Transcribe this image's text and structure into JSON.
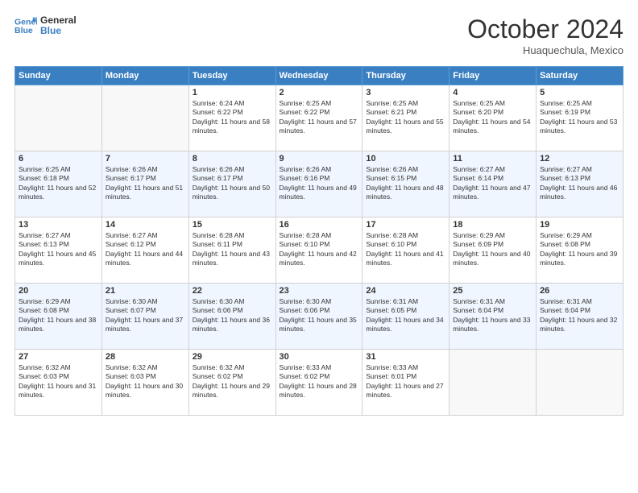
{
  "logo": {
    "line1": "General",
    "line2": "Blue"
  },
  "header": {
    "month": "October 2024",
    "location": "Huaquechula, Mexico"
  },
  "weekdays": [
    "Sunday",
    "Monday",
    "Tuesday",
    "Wednesday",
    "Thursday",
    "Friday",
    "Saturday"
  ],
  "weeks": [
    [
      {
        "day": "",
        "info": ""
      },
      {
        "day": "",
        "info": ""
      },
      {
        "day": "1",
        "info": "Sunrise: 6:24 AM\nSunset: 6:22 PM\nDaylight: 11 hours and 58 minutes."
      },
      {
        "day": "2",
        "info": "Sunrise: 6:25 AM\nSunset: 6:22 PM\nDaylight: 11 hours and 57 minutes."
      },
      {
        "day": "3",
        "info": "Sunrise: 6:25 AM\nSunset: 6:21 PM\nDaylight: 11 hours and 55 minutes."
      },
      {
        "day": "4",
        "info": "Sunrise: 6:25 AM\nSunset: 6:20 PM\nDaylight: 11 hours and 54 minutes."
      },
      {
        "day": "5",
        "info": "Sunrise: 6:25 AM\nSunset: 6:19 PM\nDaylight: 11 hours and 53 minutes."
      }
    ],
    [
      {
        "day": "6",
        "info": "Sunrise: 6:25 AM\nSunset: 6:18 PM\nDaylight: 11 hours and 52 minutes."
      },
      {
        "day": "7",
        "info": "Sunrise: 6:26 AM\nSunset: 6:17 PM\nDaylight: 11 hours and 51 minutes."
      },
      {
        "day": "8",
        "info": "Sunrise: 6:26 AM\nSunset: 6:17 PM\nDaylight: 11 hours and 50 minutes."
      },
      {
        "day": "9",
        "info": "Sunrise: 6:26 AM\nSunset: 6:16 PM\nDaylight: 11 hours and 49 minutes."
      },
      {
        "day": "10",
        "info": "Sunrise: 6:26 AM\nSunset: 6:15 PM\nDaylight: 11 hours and 48 minutes."
      },
      {
        "day": "11",
        "info": "Sunrise: 6:27 AM\nSunset: 6:14 PM\nDaylight: 11 hours and 47 minutes."
      },
      {
        "day": "12",
        "info": "Sunrise: 6:27 AM\nSunset: 6:13 PM\nDaylight: 11 hours and 46 minutes."
      }
    ],
    [
      {
        "day": "13",
        "info": "Sunrise: 6:27 AM\nSunset: 6:13 PM\nDaylight: 11 hours and 45 minutes."
      },
      {
        "day": "14",
        "info": "Sunrise: 6:27 AM\nSunset: 6:12 PM\nDaylight: 11 hours and 44 minutes."
      },
      {
        "day": "15",
        "info": "Sunrise: 6:28 AM\nSunset: 6:11 PM\nDaylight: 11 hours and 43 minutes."
      },
      {
        "day": "16",
        "info": "Sunrise: 6:28 AM\nSunset: 6:10 PM\nDaylight: 11 hours and 42 minutes."
      },
      {
        "day": "17",
        "info": "Sunrise: 6:28 AM\nSunset: 6:10 PM\nDaylight: 11 hours and 41 minutes."
      },
      {
        "day": "18",
        "info": "Sunrise: 6:29 AM\nSunset: 6:09 PM\nDaylight: 11 hours and 40 minutes."
      },
      {
        "day": "19",
        "info": "Sunrise: 6:29 AM\nSunset: 6:08 PM\nDaylight: 11 hours and 39 minutes."
      }
    ],
    [
      {
        "day": "20",
        "info": "Sunrise: 6:29 AM\nSunset: 6:08 PM\nDaylight: 11 hours and 38 minutes."
      },
      {
        "day": "21",
        "info": "Sunrise: 6:30 AM\nSunset: 6:07 PM\nDaylight: 11 hours and 37 minutes."
      },
      {
        "day": "22",
        "info": "Sunrise: 6:30 AM\nSunset: 6:06 PM\nDaylight: 11 hours and 36 minutes."
      },
      {
        "day": "23",
        "info": "Sunrise: 6:30 AM\nSunset: 6:06 PM\nDaylight: 11 hours and 35 minutes."
      },
      {
        "day": "24",
        "info": "Sunrise: 6:31 AM\nSunset: 6:05 PM\nDaylight: 11 hours and 34 minutes."
      },
      {
        "day": "25",
        "info": "Sunrise: 6:31 AM\nSunset: 6:04 PM\nDaylight: 11 hours and 33 minutes."
      },
      {
        "day": "26",
        "info": "Sunrise: 6:31 AM\nSunset: 6:04 PM\nDaylight: 11 hours and 32 minutes."
      }
    ],
    [
      {
        "day": "27",
        "info": "Sunrise: 6:32 AM\nSunset: 6:03 PM\nDaylight: 11 hours and 31 minutes."
      },
      {
        "day": "28",
        "info": "Sunrise: 6:32 AM\nSunset: 6:03 PM\nDaylight: 11 hours and 30 minutes."
      },
      {
        "day": "29",
        "info": "Sunrise: 6:32 AM\nSunset: 6:02 PM\nDaylight: 11 hours and 29 minutes."
      },
      {
        "day": "30",
        "info": "Sunrise: 6:33 AM\nSunset: 6:02 PM\nDaylight: 11 hours and 28 minutes."
      },
      {
        "day": "31",
        "info": "Sunrise: 6:33 AM\nSunset: 6:01 PM\nDaylight: 11 hours and 27 minutes."
      },
      {
        "day": "",
        "info": ""
      },
      {
        "day": "",
        "info": ""
      }
    ]
  ]
}
